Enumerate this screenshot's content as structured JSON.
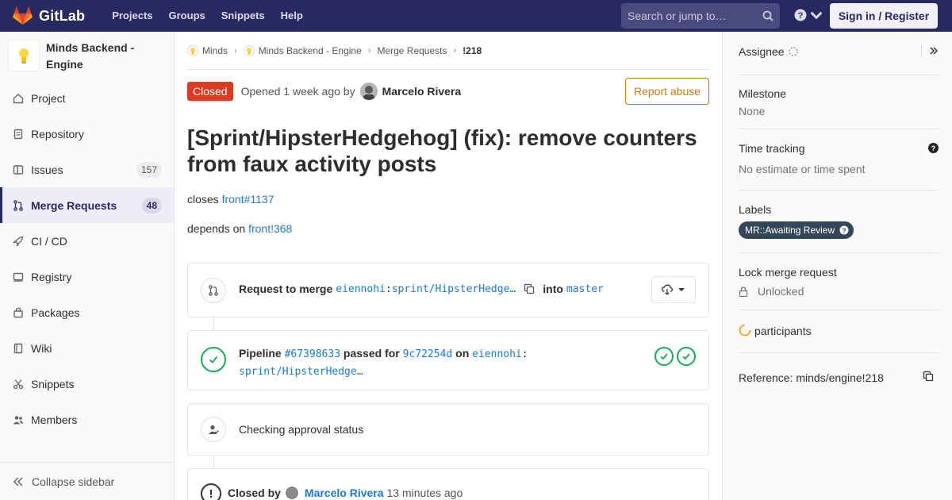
{
  "topbar": {
    "brand": "GitLab",
    "nav": [
      "Projects",
      "Groups",
      "Snippets",
      "Help"
    ],
    "search_placeholder": "Search or jump to…",
    "signin": "Sign in / Register"
  },
  "sidebar": {
    "project_name": "Minds Backend - Engine",
    "items": [
      {
        "label": "Project",
        "icon": "home-icon"
      },
      {
        "label": "Repository",
        "icon": "doc-icon"
      },
      {
        "label": "Issues",
        "icon": "issues-icon",
        "count": "157"
      },
      {
        "label": "Merge Requests",
        "icon": "merge-request-icon",
        "count": "48",
        "active": true
      },
      {
        "label": "CI / CD",
        "icon": "rocket-icon"
      },
      {
        "label": "Registry",
        "icon": "container-icon"
      },
      {
        "label": "Packages",
        "icon": "package-icon"
      },
      {
        "label": "Wiki",
        "icon": "book-icon"
      },
      {
        "label": "Snippets",
        "icon": "scissors-icon"
      },
      {
        "label": "Members",
        "icon": "users-icon"
      }
    ],
    "collapse": "Collapse sidebar"
  },
  "breadcrumb": {
    "items": [
      "Minds",
      "Minds Backend - Engine",
      "Merge Requests",
      "!218"
    ]
  },
  "mr": {
    "status": "Closed",
    "opened": "Opened 1 week ago by",
    "author": "Marcelo Rivera",
    "report": "Report abuse",
    "title": "[Sprint/HipsterHedgehog] (fix): remove counters from faux activity posts",
    "closes_prefix": "closes",
    "closes_link": "front#1137",
    "depends_prefix": "depends on",
    "depends_link": "front!368",
    "merge": {
      "prefix": "Request to merge",
      "source_user": "eiennohi",
      "source_branch": "sprint/HipsterHedge…",
      "into": "into",
      "target": "master"
    },
    "pipeline": {
      "label": "Pipeline",
      "id": "#67398633",
      "passed_for": "passed for",
      "commit": "9c72254d",
      "on": "on",
      "user": "eiennohi",
      "branch": "sprint/HipsterHedge…"
    },
    "approval": "Checking approval status",
    "closed_by": {
      "label": "Closed by",
      "author": "Marcelo Rivera",
      "when": "13 minutes ago"
    }
  },
  "right_sidebar": {
    "assignee": "Assignee",
    "milestone": "Milestone",
    "milestone_value": "None",
    "time_tracking": "Time tracking",
    "time_tracking_value": "No estimate or time spent",
    "labels": "Labels",
    "label_value": "MR::Awaiting Review",
    "lock": "Lock merge request",
    "lock_value": "Unlocked",
    "participants": "participants",
    "reference": "Reference: minds/engine!218"
  },
  "colors": {
    "navbar": "#292961",
    "closed": "#db3b21",
    "link": "#1f78d1",
    "success": "#1aaa55",
    "report": "#c17d10",
    "label": "#344759"
  }
}
